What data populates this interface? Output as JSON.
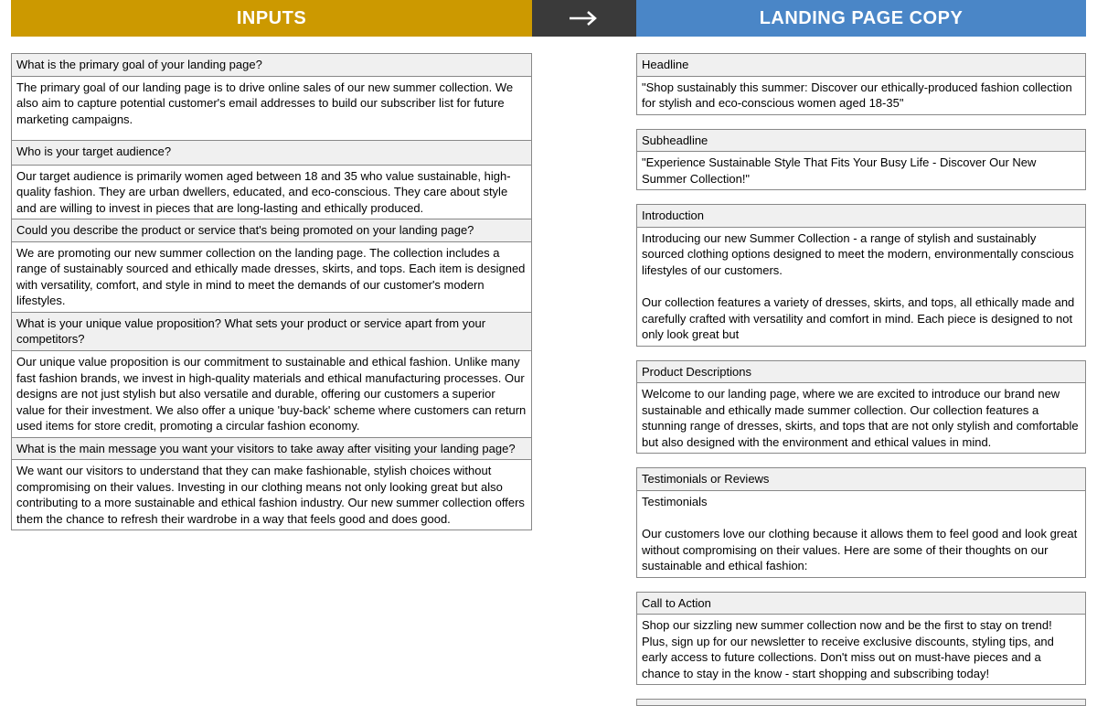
{
  "headers": {
    "inputs": "INPUTS",
    "copy": "LANDING PAGE COPY"
  },
  "inputs": [
    {
      "q": "What is the primary goal of your landing page?",
      "a": "The primary goal of our landing page is to drive online sales of our new summer collection. We also aim to capture potential customer's email addresses to build our subscriber list for future marketing campaigns.",
      "tall": true
    },
    {
      "q": "Who is your target audience?",
      "a": "Our target audience is primarily women aged between 18 and 35 who value sustainable, high-quality fashion. They are urban dwellers, educated, and eco-conscious. They care about style and are willing to invest in pieces that are long-lasting and ethically produced."
    },
    {
      "q": "Could you describe the product or service that's being promoted on your landing page?",
      "a": "We are promoting our new summer collection on the landing page. The collection includes a range of sustainably sourced and ethically made dresses, skirts, and tops. Each item is designed with versatility, comfort, and style in mind to meet the demands of our customer's modern lifestyles."
    },
    {
      "q": "What is your unique value proposition? What sets your product or service apart from your competitors?",
      "a": "Our unique value proposition is our commitment to sustainable and ethical fashion. Unlike many fast fashion brands, we invest in high-quality materials and ethical manufacturing processes. Our designs are not just stylish but also versatile and durable, offering our customers a superior value for their investment. We also offer a unique 'buy-back' scheme where customers can return used items for store credit, promoting a circular fashion economy."
    },
    {
      "q": "What is the main message you want your visitors to take away after visiting your landing page?",
      "a": "We want our visitors to understand that they can make fashionable, stylish choices without compromising on their values. Investing in our clothing means not only looking great but also contributing to a more sustainable and ethical fashion industry. Our new summer collection offers them the chance to refresh their wardrobe in a way that feels good and does good."
    }
  ],
  "copy": [
    {
      "label": "Headline",
      "body": "\"Shop sustainably this summer: Discover our ethically-produced fashion collection for stylish and eco-conscious women aged 18-35\""
    },
    {
      "label": "Subheadline",
      "body": "\"Experience Sustainable Style That Fits Your Busy Life - Discover Our New Summer Collection!\""
    },
    {
      "label": "Introduction",
      "body": "Introducing our new Summer Collection - a range of stylish and sustainably sourced clothing options designed to meet the modern, environmentally conscious lifestyles of our customers.\n\nOur collection features a variety of dresses, skirts, and tops, all ethically made and carefully crafted with versatility and comfort in mind. Each piece is designed to not only look great but"
    },
    {
      "label": "Product Descriptions",
      "body": "Welcome to our landing page, where we are excited to introduce our brand new sustainable and ethically made summer collection. Our collection features a stunning range of dresses, skirts, and tops that are not only stylish and comfortable but also designed with the environment and ethical values in mind."
    },
    {
      "label": "Testimonials or Reviews",
      "body": "Testimonials\n\nOur customers love our clothing because it allows them to feel good and look great without compromising on their values. Here are some of their thoughts on our sustainable and ethical fashion:"
    },
    {
      "label": "Call to Action",
      "body": "Shop our sizzling new summer collection now and be the first to stay on trend! Plus, sign up for our newsletter to receive exclusive discounts, styling tips, and early access to future collections. Don't miss out on must-have pieces and a chance to stay in the know - start shopping and subscribing today!"
    }
  ]
}
